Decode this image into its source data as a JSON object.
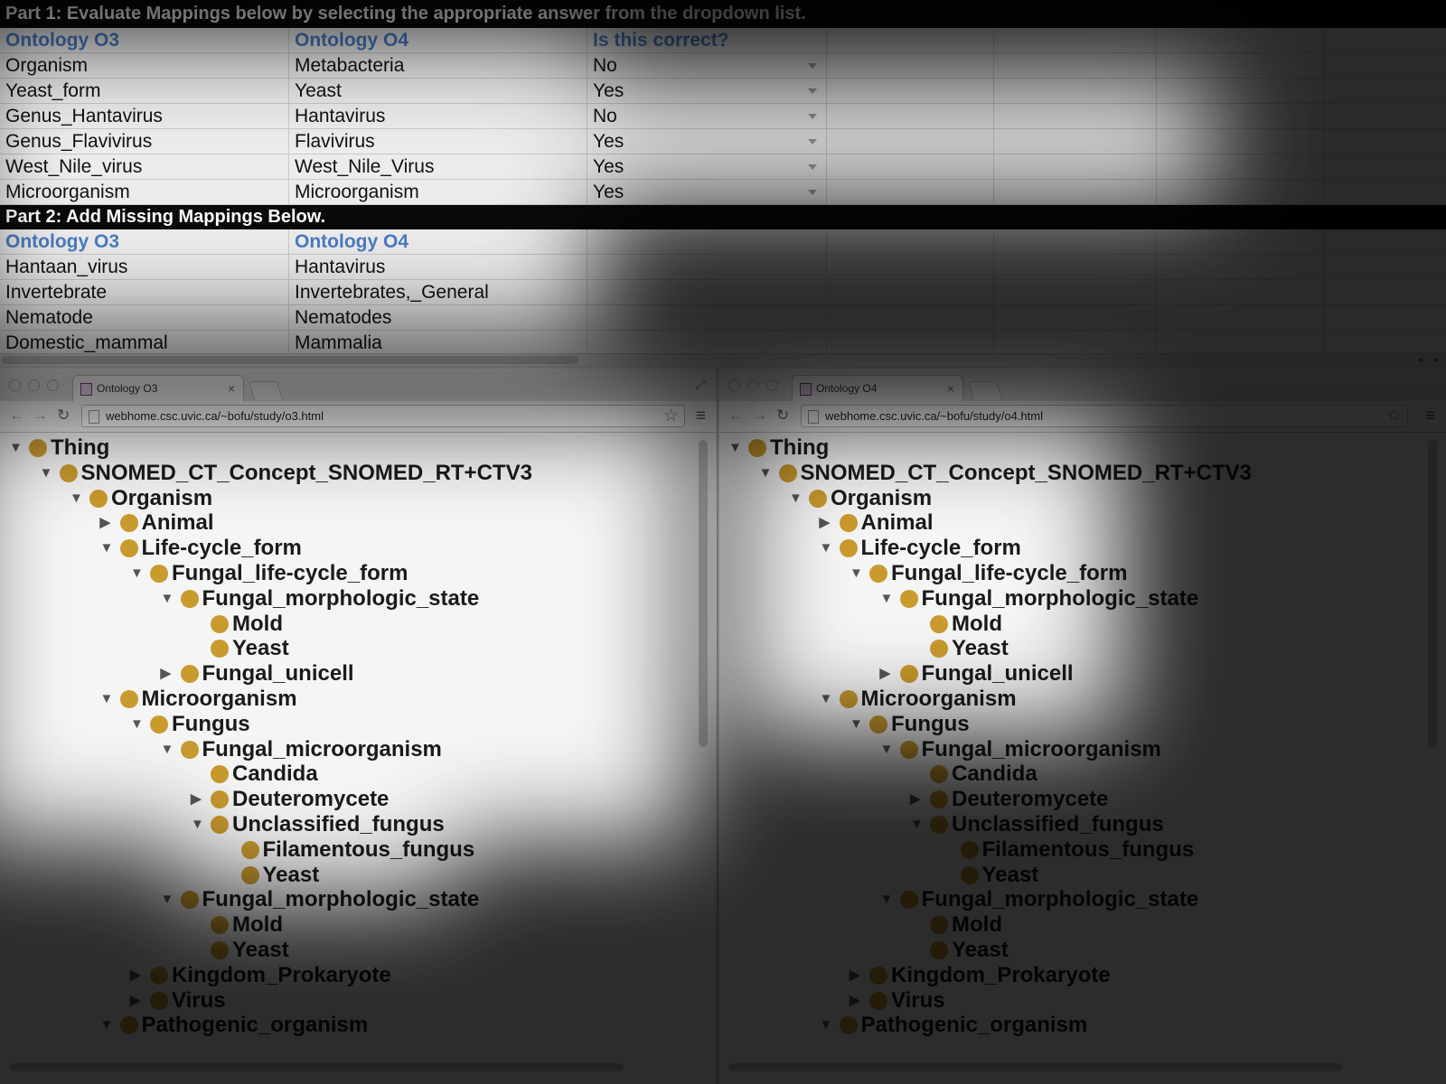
{
  "sheet": {
    "part1_title": "Part 1: Evaluate Mappings below by selecting the appropriate answer from the dropdown list.",
    "part1_headers": [
      "Ontology O3",
      "Ontology O4",
      "Is this correct?"
    ],
    "part1_rows": [
      [
        "Organism",
        "Metabacteria",
        "No"
      ],
      [
        "Yeast_form",
        "Yeast",
        "Yes"
      ],
      [
        "Genus_Hantavirus",
        "Hantavirus",
        "No"
      ],
      [
        "Genus_Flavivirus",
        "Flavivirus",
        "Yes"
      ],
      [
        "West_Nile_virus",
        "West_Nile_Virus",
        "Yes"
      ],
      [
        "Microorganism",
        "Microorganism",
        "Yes"
      ]
    ],
    "part2_title": "Part 2: Add Missing Mappings Below.",
    "part2_headers": [
      "Ontology O3",
      "Ontology O4"
    ],
    "part2_rows": [
      [
        "Hantaan_virus",
        "Hantavirus"
      ],
      [
        "Invertebrate",
        "Invertebrates,_General"
      ],
      [
        "Nematode",
        "Nematodes"
      ],
      [
        "Domestic_mammal",
        "Mammalia"
      ]
    ],
    "scroll_left_arrow": "◂",
    "scroll_right_arrow": "▸"
  },
  "left_browser": {
    "tab_title": "Ontology O3",
    "tab_close": "×",
    "url": "webhome.csc.uvic.ca/~bofu/study/o3.html"
  },
  "right_browser": {
    "tab_title": "Ontology O4",
    "tab_close": "×",
    "url": "webhome.csc.uvic.ca/~bofu/study/o4.html"
  },
  "icons": {
    "back": "←",
    "forward": "→",
    "reload": "↻",
    "star": "☆",
    "menu": "≡",
    "expand": "⤢",
    "expanded": "▼",
    "collapsed": "▶"
  },
  "colors": {
    "node_dot": "#c99a2e",
    "header_blue": "#4a7bc4"
  },
  "tree": [
    {
      "label": "Thing",
      "depth": 0,
      "state": "expanded"
    },
    {
      "label": "SNOMED_CT_Concept_SNOMED_RT+CTV3",
      "depth": 1,
      "state": "expanded"
    },
    {
      "label": "Organism",
      "depth": 2,
      "state": "expanded"
    },
    {
      "label": "Animal",
      "depth": 3,
      "state": "collapsed"
    },
    {
      "label": "Life-cycle_form",
      "depth": 3,
      "state": "expanded"
    },
    {
      "label": "Fungal_life-cycle_form",
      "depth": 4,
      "state": "expanded"
    },
    {
      "label": "Fungal_morphologic_state",
      "depth": 5,
      "state": "expanded"
    },
    {
      "label": "Mold",
      "depth": 6,
      "state": "leaf"
    },
    {
      "label": "Yeast",
      "depth": 6,
      "state": "leaf"
    },
    {
      "label": "Fungal_unicell",
      "depth": 5,
      "state": "collapsed"
    },
    {
      "label": "Microorganism",
      "depth": 3,
      "state": "expanded"
    },
    {
      "label": "Fungus",
      "depth": 4,
      "state": "expanded"
    },
    {
      "label": "Fungal_microorganism",
      "depth": 5,
      "state": "expanded"
    },
    {
      "label": "Candida",
      "depth": 6,
      "state": "leaf"
    },
    {
      "label": "Deuteromycete",
      "depth": 6,
      "state": "collapsed"
    },
    {
      "label": "Unclassified_fungus",
      "depth": 6,
      "state": "expanded"
    },
    {
      "label": "Filamentous_fungus",
      "depth": 7,
      "state": "leaf"
    },
    {
      "label": "Yeast",
      "depth": 7,
      "state": "leaf"
    },
    {
      "label": "Fungal_morphologic_state",
      "depth": 5,
      "state": "expanded"
    },
    {
      "label": "Mold",
      "depth": 6,
      "state": "leaf"
    },
    {
      "label": "Yeast",
      "depth": 6,
      "state": "leaf"
    },
    {
      "label": "Kingdom_Prokaryote",
      "depth": 4,
      "state": "collapsed"
    },
    {
      "label": "Virus",
      "depth": 4,
      "state": "collapsed"
    },
    {
      "label": "Pathogenic_organism",
      "depth": 3,
      "state": "expanded"
    }
  ]
}
